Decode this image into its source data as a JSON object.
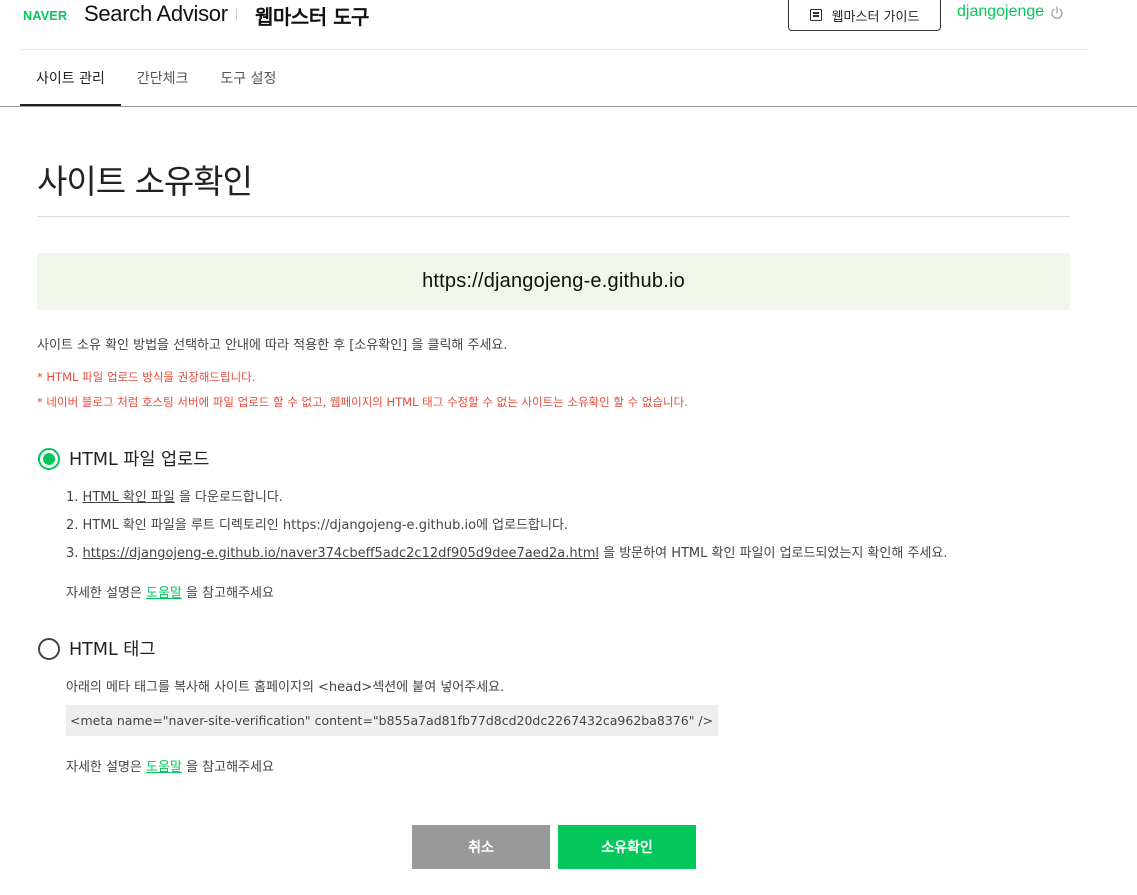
{
  "header": {
    "brand": "NAVER",
    "product": "Search Advisor",
    "section": "웹마스터 도구",
    "guide_label": "웹마스터 가이드",
    "guide_icon": "document-list-icon",
    "username": "djangojenge",
    "logout_icon": "power-icon"
  },
  "tabs": [
    {
      "label": "사이트 관리",
      "active": true
    },
    {
      "label": "간단체크",
      "active": false
    },
    {
      "label": "도구 설정",
      "active": false
    }
  ],
  "main": {
    "title": "사이트 소유확인",
    "site_url": "https://djangojeng-e.github.io",
    "description": "사이트 소유 확인 방법을 선택하고 안내에 따라 적용한 후 [소유확인] 을 클릭해 주세요.",
    "warnings": [
      "* HTML 파일 업로드 방식을 권장해드립니다.",
      "* 네이버 블로그 처럼 호스팅 서버에 파일 업로드 할 수 없고, 웹페이지의 HTML 태그 수정할 수 없는 사이트는 소유확인 할 수 없습니다."
    ]
  },
  "option_file": {
    "label": "HTML 파일 업로드",
    "selected": true,
    "step1_prefix": "1. ",
    "step1_link": "HTML 확인 파일",
    "step1_suffix": " 을 다운로드합니다.",
    "step2": "2. HTML 확인 파일을 루트 디렉토리인 https://djangojeng-e.github.io에 업로드합니다.",
    "step3_prefix": "3. ",
    "step3_link": "https://djangojeng-e.github.io/naver374cbeff5adc2c12df905d9dee7aed2a.html",
    "step3_suffix": " 을 방문하여 HTML 확인 파일이 업로드되었는지 확인해 주세요.",
    "help_prefix": "자세한 설명은 ",
    "help_link": "도움말",
    "help_suffix": " 을 참고해주세요"
  },
  "option_tag": {
    "label": "HTML 태그",
    "selected": false,
    "instruction": "아래의 메타 태그를 복사해 사이트 홈페이지의 <head>섹션에 붙여 넣어주세요.",
    "meta_tag": "<meta name=\"naver-site-verification\" content=\"b855a7ad81fb77d8cd20dc2267432ca962ba8376\" />",
    "help_prefix": "자세한 설명은 ",
    "help_link": "도움말",
    "help_suffix": " 을 참고해주세요"
  },
  "buttons": {
    "cancel": "취소",
    "confirm": "소유확인"
  },
  "colors": {
    "accent": "#03c75a",
    "warning": "#e74c3c",
    "site_box_bg": "#f0f6ea",
    "cancel_bg": "#999999"
  }
}
